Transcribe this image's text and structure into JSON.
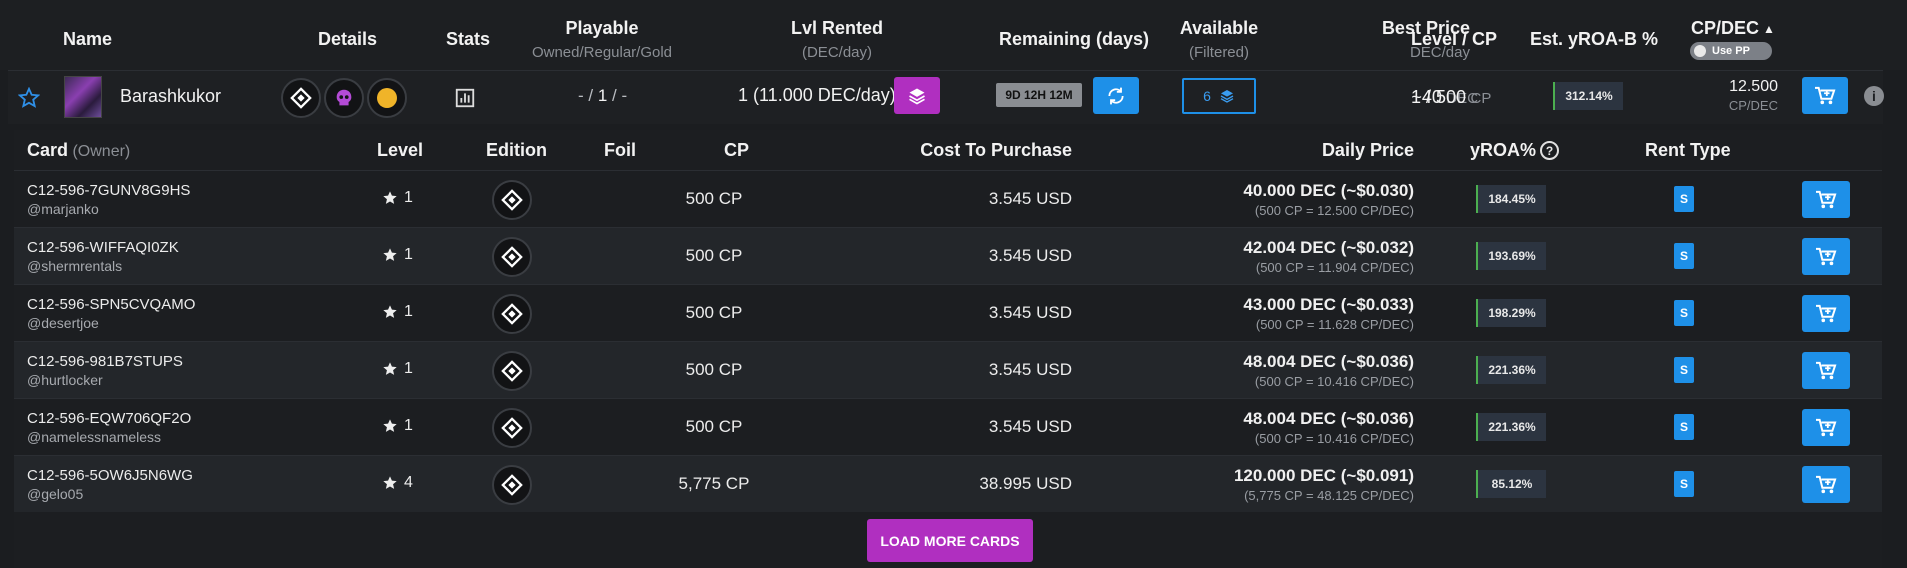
{
  "header": {
    "name": "Name",
    "details": "Details",
    "stats": "Stats",
    "playable": "Playable",
    "playable_sub": "Owned/Regular/Gold",
    "lvl_rented": "Lvl Rented",
    "lvl_rented_sub": "(DEC/day)",
    "remaining": "Remaining (days)",
    "available": "Available",
    "available_sub": "(Filtered)",
    "best_price": "Best Price",
    "best_price_sub": "DEC/day",
    "level_cp": "Level / CP",
    "est_yroa": "Est. yROA-B %",
    "cp_dec": "CP/DEC",
    "use_pp": "Use PP"
  },
  "summary": {
    "name": "Barashkukor",
    "playable_a": "- /",
    "playable_b": "1",
    "playable_c": "/ -",
    "lvl_rented": "1 (11.000 DEC/day)",
    "remaining": "9D 12H 12M",
    "available_count": "6",
    "best_price": "~40",
    "best_price_unit": "DEC",
    "level": "1 / 500",
    "level_unit": "CP",
    "est_yroa": "312.14%",
    "cp_dec": "12.500",
    "cp_dec_unit": "CP/DEC"
  },
  "table": {
    "col_card": "Card",
    "col_owner": "(Owner)",
    "col_level": "Level",
    "col_edition": "Edition",
    "col_foil": "Foil",
    "col_cp": "CP",
    "col_cost": "Cost To Purchase",
    "col_daily": "Daily Price",
    "col_yroa": "yROA%",
    "col_rent_type": "Rent Type",
    "rows": [
      {
        "id": "C12-596-7GUNV8G9HS",
        "owner": "@marjanko",
        "level": "1",
        "cp": "500 CP",
        "cost": "3.545 USD",
        "price": "40.000 DEC (~$0.030)",
        "price_sub": "(500 CP = 12.500 CP/DEC)",
        "yroa": "184.45%",
        "rent_type": "S"
      },
      {
        "id": "C12-596-WIFFAQI0ZK",
        "owner": "@shermrentals",
        "level": "1",
        "cp": "500 CP",
        "cost": "3.545 USD",
        "price": "42.004 DEC (~$0.032)",
        "price_sub": "(500 CP = 11.904 CP/DEC)",
        "yroa": "193.69%",
        "rent_type": "S"
      },
      {
        "id": "C12-596-SPN5CVQAMO",
        "owner": "@desertjoe",
        "level": "1",
        "cp": "500 CP",
        "cost": "3.545 USD",
        "price": "43.000 DEC (~$0.033)",
        "price_sub": "(500 CP = 11.628 CP/DEC)",
        "yroa": "198.29%",
        "rent_type": "S"
      },
      {
        "id": "C12-596-981B7STUPS",
        "owner": "@hurtlocker",
        "level": "1",
        "cp": "500 CP",
        "cost": "3.545 USD",
        "price": "48.004 DEC (~$0.036)",
        "price_sub": "(500 CP = 10.416 CP/DEC)",
        "yroa": "221.36%",
        "rent_type": "S"
      },
      {
        "id": "C12-596-EQW706QF2O",
        "owner": "@namelessnameless",
        "level": "1",
        "cp": "500 CP",
        "cost": "3.545 USD",
        "price": "48.004 DEC (~$0.036)",
        "price_sub": "(500 CP = 10.416 CP/DEC)",
        "yroa": "221.36%",
        "rent_type": "S"
      },
      {
        "id": "C12-596-5OW6J5N6WG",
        "owner": "@gelo05",
        "level": "4",
        "cp": "5,775 CP",
        "cost": "38.995 USD",
        "price": "120.000 DEC (~$0.091)",
        "price_sub": "(5,775 CP = 48.125 CP/DEC)",
        "yroa": "85.12%",
        "rent_type": "S"
      }
    ]
  },
  "load_more": "LOAD MORE CARDS",
  "colors": {
    "accent_blue": "#1e90e8",
    "accent_purple": "#b02fc0",
    "yroa_bar": "#4caf50",
    "skull_purple": "#b44bd6",
    "coin_gold": "#f0b429"
  }
}
